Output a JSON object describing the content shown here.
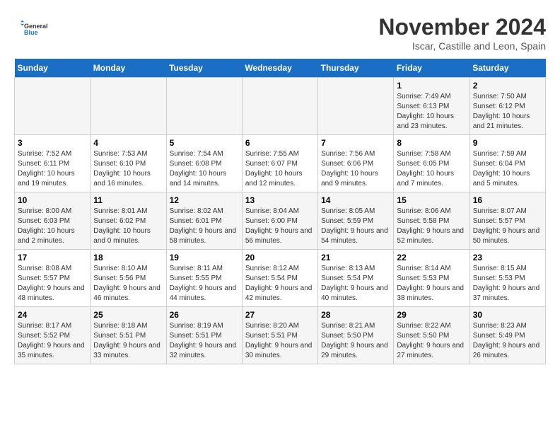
{
  "logo": {
    "line1": "General",
    "line2": "Blue"
  },
  "title": "November 2024",
  "location": "Iscar, Castille and Leon, Spain",
  "weekdays": [
    "Sunday",
    "Monday",
    "Tuesday",
    "Wednesday",
    "Thursday",
    "Friday",
    "Saturday"
  ],
  "weeks": [
    [
      {
        "day": "",
        "info": ""
      },
      {
        "day": "",
        "info": ""
      },
      {
        "day": "",
        "info": ""
      },
      {
        "day": "",
        "info": ""
      },
      {
        "day": "",
        "info": ""
      },
      {
        "day": "1",
        "info": "Sunrise: 7:49 AM\nSunset: 6:13 PM\nDaylight: 10 hours and 23 minutes."
      },
      {
        "day": "2",
        "info": "Sunrise: 7:50 AM\nSunset: 6:12 PM\nDaylight: 10 hours and 21 minutes."
      }
    ],
    [
      {
        "day": "3",
        "info": "Sunrise: 7:52 AM\nSunset: 6:11 PM\nDaylight: 10 hours and 19 minutes."
      },
      {
        "day": "4",
        "info": "Sunrise: 7:53 AM\nSunset: 6:10 PM\nDaylight: 10 hours and 16 minutes."
      },
      {
        "day": "5",
        "info": "Sunrise: 7:54 AM\nSunset: 6:08 PM\nDaylight: 10 hours and 14 minutes."
      },
      {
        "day": "6",
        "info": "Sunrise: 7:55 AM\nSunset: 6:07 PM\nDaylight: 10 hours and 12 minutes."
      },
      {
        "day": "7",
        "info": "Sunrise: 7:56 AM\nSunset: 6:06 PM\nDaylight: 10 hours and 9 minutes."
      },
      {
        "day": "8",
        "info": "Sunrise: 7:58 AM\nSunset: 6:05 PM\nDaylight: 10 hours and 7 minutes."
      },
      {
        "day": "9",
        "info": "Sunrise: 7:59 AM\nSunset: 6:04 PM\nDaylight: 10 hours and 5 minutes."
      }
    ],
    [
      {
        "day": "10",
        "info": "Sunrise: 8:00 AM\nSunset: 6:03 PM\nDaylight: 10 hours and 2 minutes."
      },
      {
        "day": "11",
        "info": "Sunrise: 8:01 AM\nSunset: 6:02 PM\nDaylight: 10 hours and 0 minutes."
      },
      {
        "day": "12",
        "info": "Sunrise: 8:02 AM\nSunset: 6:01 PM\nDaylight: 9 hours and 58 minutes."
      },
      {
        "day": "13",
        "info": "Sunrise: 8:04 AM\nSunset: 6:00 PM\nDaylight: 9 hours and 56 minutes."
      },
      {
        "day": "14",
        "info": "Sunrise: 8:05 AM\nSunset: 5:59 PM\nDaylight: 9 hours and 54 minutes."
      },
      {
        "day": "15",
        "info": "Sunrise: 8:06 AM\nSunset: 5:58 PM\nDaylight: 9 hours and 52 minutes."
      },
      {
        "day": "16",
        "info": "Sunrise: 8:07 AM\nSunset: 5:57 PM\nDaylight: 9 hours and 50 minutes."
      }
    ],
    [
      {
        "day": "17",
        "info": "Sunrise: 8:08 AM\nSunset: 5:57 PM\nDaylight: 9 hours and 48 minutes."
      },
      {
        "day": "18",
        "info": "Sunrise: 8:10 AM\nSunset: 5:56 PM\nDaylight: 9 hours and 46 minutes."
      },
      {
        "day": "19",
        "info": "Sunrise: 8:11 AM\nSunset: 5:55 PM\nDaylight: 9 hours and 44 minutes."
      },
      {
        "day": "20",
        "info": "Sunrise: 8:12 AM\nSunset: 5:54 PM\nDaylight: 9 hours and 42 minutes."
      },
      {
        "day": "21",
        "info": "Sunrise: 8:13 AM\nSunset: 5:54 PM\nDaylight: 9 hours and 40 minutes."
      },
      {
        "day": "22",
        "info": "Sunrise: 8:14 AM\nSunset: 5:53 PM\nDaylight: 9 hours and 38 minutes."
      },
      {
        "day": "23",
        "info": "Sunrise: 8:15 AM\nSunset: 5:53 PM\nDaylight: 9 hours and 37 minutes."
      }
    ],
    [
      {
        "day": "24",
        "info": "Sunrise: 8:17 AM\nSunset: 5:52 PM\nDaylight: 9 hours and 35 minutes."
      },
      {
        "day": "25",
        "info": "Sunrise: 8:18 AM\nSunset: 5:51 PM\nDaylight: 9 hours and 33 minutes."
      },
      {
        "day": "26",
        "info": "Sunrise: 8:19 AM\nSunset: 5:51 PM\nDaylight: 9 hours and 32 minutes."
      },
      {
        "day": "27",
        "info": "Sunrise: 8:20 AM\nSunset: 5:51 PM\nDaylight: 9 hours and 30 minutes."
      },
      {
        "day": "28",
        "info": "Sunrise: 8:21 AM\nSunset: 5:50 PM\nDaylight: 9 hours and 29 minutes."
      },
      {
        "day": "29",
        "info": "Sunrise: 8:22 AM\nSunset: 5:50 PM\nDaylight: 9 hours and 27 minutes."
      },
      {
        "day": "30",
        "info": "Sunrise: 8:23 AM\nSunset: 5:49 PM\nDaylight: 9 hours and 26 minutes."
      }
    ]
  ]
}
